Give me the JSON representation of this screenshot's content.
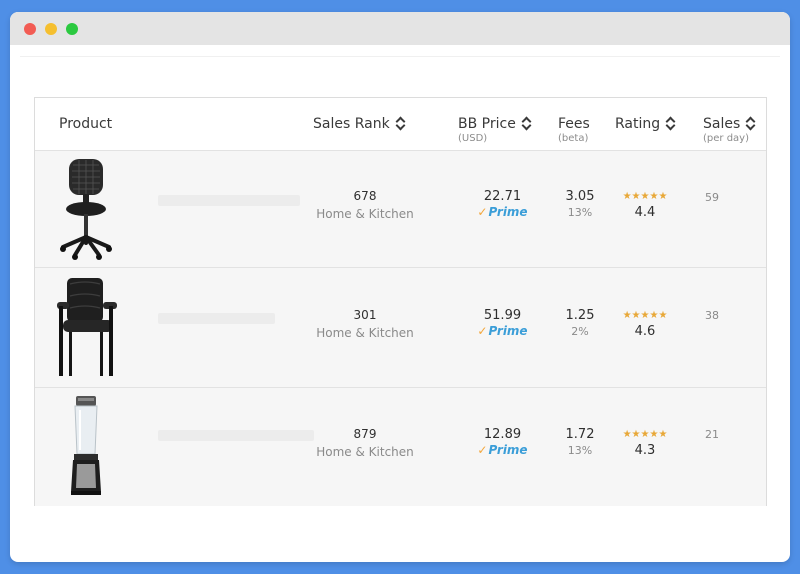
{
  "colors": {
    "background": "#4f8fe6",
    "star": "#e8a838",
    "prime": "#3b9ed8"
  },
  "table": {
    "headers": {
      "product": "Product",
      "sales_rank": "Sales Rank",
      "bb_price": "BB Price",
      "bb_price_sub": "(USD)",
      "fees": "Fees",
      "fees_sub": "(beta)",
      "rating": "Rating",
      "sales": "Sales",
      "sales_sub": "(per day)"
    },
    "rows": [
      {
        "image": "office-chair-mesh",
        "rank": "678",
        "category": "Home & Kitchen",
        "price": "22.71",
        "prime": "Prime",
        "fee": "3.05",
        "fee_pct": "13%",
        "stars": "★★★★★",
        "rating": "4.4",
        "sales": "59"
      },
      {
        "image": "leather-office-chair",
        "rank": "301",
        "category": "Home & Kitchen",
        "price": "51.99",
        "prime": "Prime",
        "fee": "1.25",
        "fee_pct": "2%",
        "stars": "★★★★★",
        "rating": "4.6",
        "sales": "38"
      },
      {
        "image": "personal-blender",
        "rank": "879",
        "category": "Home & Kitchen",
        "price": "12.89",
        "prime": "Prime",
        "fee": "1.72",
        "fee_pct": "13%",
        "stars": "★★★★★",
        "rating": "4.3",
        "sales": "21"
      }
    ]
  }
}
